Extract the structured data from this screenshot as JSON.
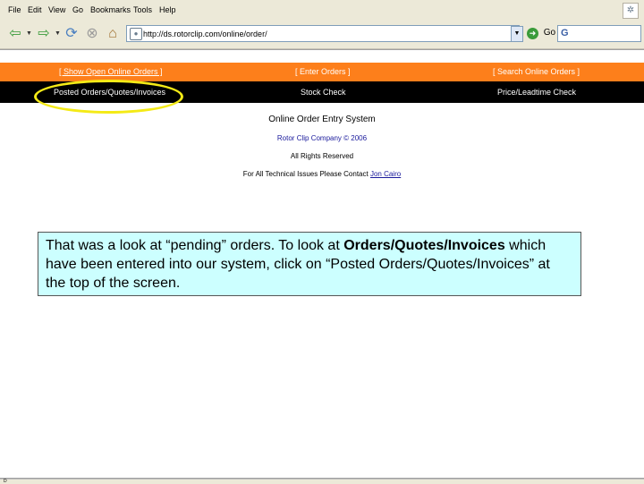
{
  "menubar": {
    "items": [
      "File",
      "Edit",
      "View",
      "Go",
      "Bookmarks",
      "Tools",
      "Help"
    ]
  },
  "toolbar": {
    "address_value": "http://ds.rotorclip.com/online/order/",
    "go_label": "Go",
    "search_value": "G"
  },
  "nav": {
    "top": {
      "show_orders": "[ Show Open Online Orders ]",
      "enter_orders": "[ Enter Orders ]",
      "search_orders": "[ Search Online Orders ]"
    },
    "bottom": {
      "posted": "Posted Orders/Quotes/Invoices",
      "stock": "Stock Check",
      "price": "Price/Leadtime Check"
    }
  },
  "page": {
    "title": "Online Order Entry System",
    "company": "Rotor Clip Company © 2006",
    "rights": "All Rights Reserved",
    "support_prefix": "For All Technical Issues Please Contact",
    "support_name": "Jon Cairo"
  },
  "callout": {
    "part1": "That was a look at “pending” orders.  To look at ",
    "bold": "Orders/Quotes/Invoices",
    "part2": " which have been entered into our system, click on “Posted Orders/Quotes/Invoices”  at the top of the screen."
  },
  "status": {
    "text": "D"
  },
  "colors": {
    "orange_bar": "#fd7f1b",
    "black_bar": "#000000",
    "callout_bg": "#ccffff",
    "highlight": "#f4ea16"
  },
  "icons": [
    "back-arrow-icon",
    "forward-arrow-icon",
    "reload-icon",
    "stop-icon",
    "home-icon",
    "site-icon",
    "go-icon",
    "throbber-icon"
  ]
}
